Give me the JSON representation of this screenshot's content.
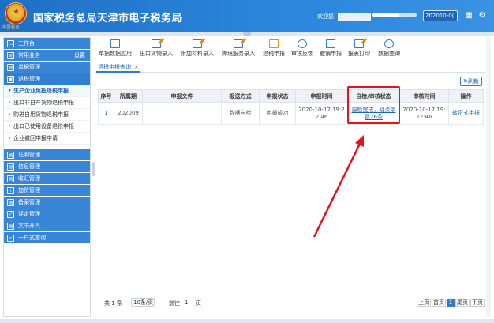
{
  "header": {
    "title": "国家税务总局天津市电子税务局",
    "logo_text": "中国税务",
    "welcome": "欢迎您!",
    "period": "202010-0("
  },
  "sidebar": {
    "items": [
      {
        "label": "工作台",
        "type": "head"
      },
      {
        "label": "常用业务",
        "type": "head",
        "right": "设置"
      },
      {
        "label": "单据管理",
        "type": "head"
      },
      {
        "label": "退税管理",
        "type": "head"
      },
      {
        "label": "生产企业免抵退税申报",
        "type": "sub",
        "active": true
      },
      {
        "label": "出口非自产货物退税申报",
        "type": "sub"
      },
      {
        "label": "购进自用货物退税申报",
        "type": "sub"
      },
      {
        "label": "出口已使用设备退税申报",
        "type": "sub"
      },
      {
        "label": "企业撤回申报申请",
        "type": "sub"
      },
      {
        "label": "证明管理",
        "type": "head"
      },
      {
        "label": "信息管理",
        "type": "head"
      },
      {
        "label": "收汇管理",
        "type": "head"
      },
      {
        "label": "加贸管理",
        "type": "head"
      },
      {
        "label": "备案管理",
        "type": "head"
      },
      {
        "label": "评定管理",
        "type": "head"
      },
      {
        "label": "文书开具",
        "type": "head"
      },
      {
        "label": "一户式查询",
        "type": "head"
      }
    ]
  },
  "toolbar": {
    "items": [
      {
        "label": "单据数据应用",
        "icon": "data-table-icon"
      },
      {
        "label": "出口货物录入",
        "icon": "edit-icon"
      },
      {
        "label": "附加材料录入",
        "icon": "edit-icon"
      },
      {
        "label": "跨境服务录入",
        "icon": "edit-icon"
      },
      {
        "label": "退税申报",
        "icon": "download-icon"
      },
      {
        "label": "审核反馈",
        "icon": "feedback-icon"
      },
      {
        "label": "撤销申报",
        "icon": "undo-icon"
      },
      {
        "label": "报表打印",
        "icon": "print-icon"
      },
      {
        "label": "数据查询",
        "icon": "search-icon"
      }
    ]
  },
  "tabs": [
    {
      "label": "退税申报查询",
      "close": "×"
    }
  ],
  "refresh_label": "刷新",
  "table": {
    "columns": [
      "序号",
      "所属期",
      "申报文件",
      "报送方式",
      "申报状态",
      "申报时间",
      "自检/审核状态",
      "审核时间",
      "操作"
    ],
    "rows": [
      {
        "index": "1",
        "period": "202009",
        "file": "",
        "method": "数据自检",
        "status": "申报成功",
        "submit_time": "2020-10-17 19:22:46",
        "check_status": "自检完成，疑点条数26条",
        "review_time": "2020-10-17 19:22:46",
        "action": "转正式申报"
      }
    ]
  },
  "pager": {
    "total": "共 1 条",
    "page_size": "10条/页",
    "goto_label": "前往",
    "goto_value": "1",
    "page_unit": "页",
    "prev": "上页",
    "first": "首页",
    "current": "1",
    "last": "尾页",
    "next": "下页"
  },
  "colors": {
    "header_blue": "#2a86dc",
    "sidebar_blue": "#3a86d6",
    "link_blue": "#1d63b8",
    "highlight_red": "#e0141a"
  }
}
